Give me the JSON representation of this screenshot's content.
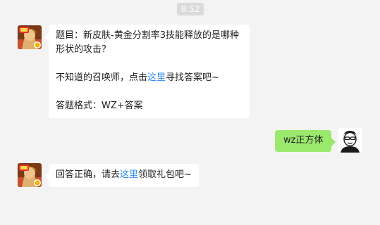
{
  "timestamp": "8:52",
  "colors": {
    "background": "#f3f3f3",
    "incoming_bubble": "#ffffff",
    "outgoing_bubble": "#9ae86c",
    "link": "#2c8ef8",
    "timestamp_bg": "#dadada"
  },
  "messages": [
    {
      "sender": "bot",
      "avatar_icon": "game-hero-avatar-icon",
      "question": "题目：新皮肤-黄金分割率3技能释放的是哪种形状的攻击？",
      "hint_before": "不知道的召唤师，点击",
      "hint_link": "这里",
      "hint_after": "寻找答案吧~",
      "format": "答题格式：WZ+答案"
    },
    {
      "sender": "user",
      "avatar_icon": "user-face-avatar-icon",
      "text": "wz正方体"
    },
    {
      "sender": "bot",
      "avatar_icon": "game-hero-avatar-icon",
      "reply_before": "回答正确，请去",
      "reply_link": "这里",
      "reply_after": "领取礼包吧~"
    }
  ]
}
